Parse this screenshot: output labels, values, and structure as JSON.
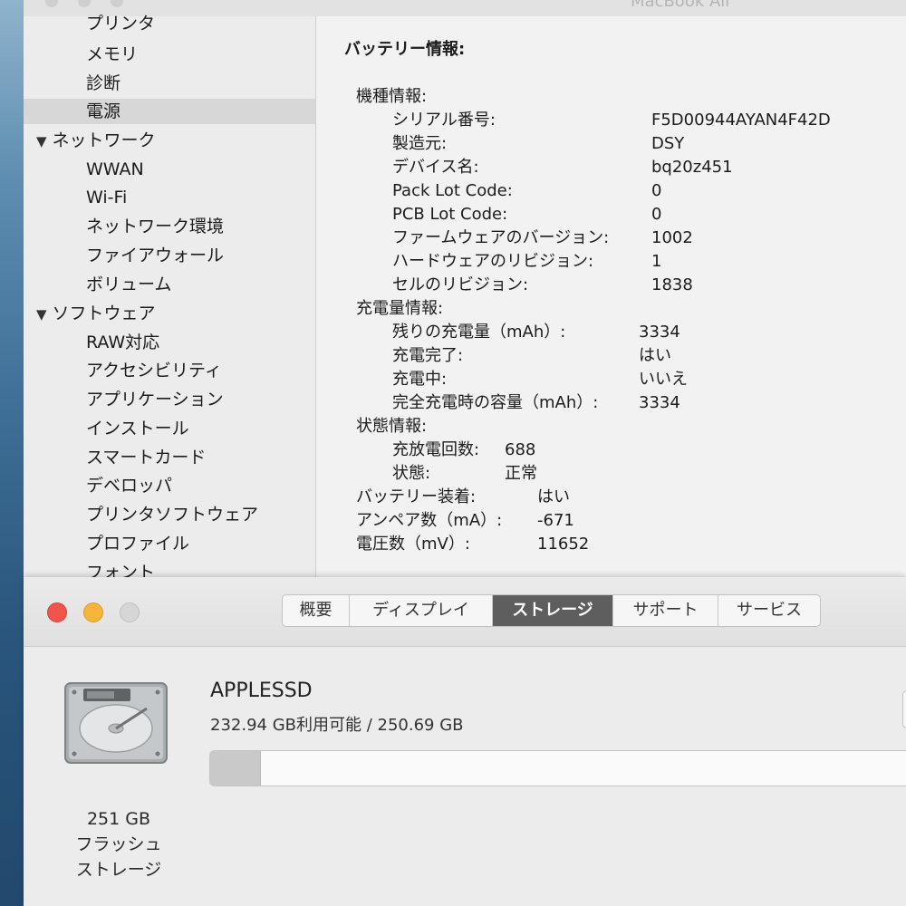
{
  "system_info": {
    "window_title": "MacBook Air",
    "sidebar": {
      "items": [
        {
          "label": "プリンタ",
          "kind": "child"
        },
        {
          "label": "メモリ",
          "kind": "child"
        },
        {
          "label": "診断",
          "kind": "child"
        },
        {
          "label": "電源",
          "kind": "child",
          "selected": true
        },
        {
          "label": "ネットワーク",
          "kind": "group"
        },
        {
          "label": "WWAN",
          "kind": "child"
        },
        {
          "label": "Wi-Fi",
          "kind": "child"
        },
        {
          "label": "ネットワーク環境",
          "kind": "child"
        },
        {
          "label": "ファイアウォール",
          "kind": "child"
        },
        {
          "label": "ボリューム",
          "kind": "child"
        },
        {
          "label": "ソフトウェア",
          "kind": "group"
        },
        {
          "label": "RAW対応",
          "kind": "child"
        },
        {
          "label": "アクセシビリティ",
          "kind": "child"
        },
        {
          "label": "アプリケーション",
          "kind": "child"
        },
        {
          "label": "インストール",
          "kind": "child"
        },
        {
          "label": "スマートカード",
          "kind": "child"
        },
        {
          "label": "デベロッパ",
          "kind": "child"
        },
        {
          "label": "プリンタソフトウェア",
          "kind": "child"
        },
        {
          "label": "プロファイル",
          "kind": "child"
        },
        {
          "label": "フォント",
          "kind": "child"
        }
      ],
      "arrow_glyph": "▼"
    },
    "battery": {
      "title": "バッテリー情報:",
      "model_info": {
        "header": "機種情報:",
        "rows": [
          {
            "label": "シリアル番号:",
            "value": "F5D00944AYAN4F42D"
          },
          {
            "label": "製造元:",
            "value": "DSY"
          },
          {
            "label": "デバイス名:",
            "value": "bq20z451"
          },
          {
            "label": "Pack Lot Code:",
            "value": "0"
          },
          {
            "label": "PCB Lot Code:",
            "value": "0"
          },
          {
            "label": "ファームウェアのバージョン:",
            "value": "1002"
          },
          {
            "label": "ハードウェアのリビジョン:",
            "value": "1"
          },
          {
            "label": "セルのリビジョン:",
            "value": "1838"
          }
        ]
      },
      "charge_info": {
        "header": "充電量情報:",
        "rows": [
          {
            "label": "残りの充電量（mAh）:",
            "value": "3334"
          },
          {
            "label": "充電完了:",
            "value": "はい"
          },
          {
            "label": "充電中:",
            "value": "いいえ"
          },
          {
            "label": "完全充電時の容量（mAh）:",
            "value": "3334"
          }
        ]
      },
      "health_info": {
        "header": "状態情報:",
        "rows": [
          {
            "label": "充放電回数:",
            "value": "688"
          },
          {
            "label": "状態:",
            "value": "正常"
          }
        ]
      },
      "top_rows": [
        {
          "label": "バッテリー装着:",
          "value": "はい"
        },
        {
          "label": "アンペア数（mA）:",
          "value": "-671"
        },
        {
          "label": "電圧数（mV）:",
          "value": "11652"
        }
      ]
    }
  },
  "about_this_mac": {
    "tabs": [
      {
        "label": "概要"
      },
      {
        "label": "ディスプレイ"
      },
      {
        "label": "ストレージ",
        "active": true
      },
      {
        "label": "サポート"
      },
      {
        "label": "サービス"
      }
    ],
    "storage": {
      "disk_name": "APPLESSD",
      "available_text": "232.94 GB利用可能 / 250.69 GB",
      "used_fraction": 0.071,
      "icon": "hard-disk-icon",
      "capacity_line1": "251 GB",
      "capacity_line2": "フラッシュ",
      "capacity_line3": "ストレージ"
    }
  },
  "colors": {
    "close": "#f0544c",
    "minimize": "#f6b43a",
    "zoom": "#d6d6d6",
    "active_tab": "#5e5e5e"
  }
}
